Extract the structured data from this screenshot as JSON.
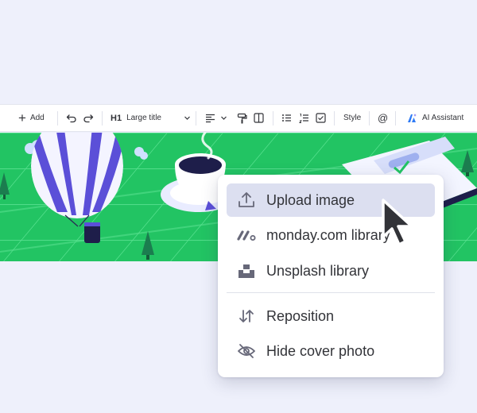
{
  "toolbar": {
    "add_label": "Add",
    "heading_label": "H1",
    "heading_value": "Large title",
    "style_label": "Style",
    "mention_symbol": "@",
    "ai_label": "AI Assistant"
  },
  "cover_menu": {
    "items": [
      {
        "label": "Upload image",
        "icon": "upload-icon",
        "highlighted": true
      },
      {
        "label": "monday.com library",
        "icon": "monday-logo-icon",
        "highlighted": false
      },
      {
        "label": "Unsplash library",
        "icon": "unsplash-logo-icon",
        "highlighted": false
      },
      {
        "label": "Reposition",
        "icon": "reposition-arrows-icon",
        "highlighted": false
      },
      {
        "label": "Hide cover photo",
        "icon": "eye-off-icon",
        "highlighted": false
      }
    ]
  },
  "colors": {
    "page_background": "#eef0fb",
    "cover_green": "#22c463",
    "menu_highlight": "#dcdff0",
    "text": "#323338",
    "balloon_purple": "#5b4fd8",
    "ai_blue": "#2f7bf5"
  }
}
